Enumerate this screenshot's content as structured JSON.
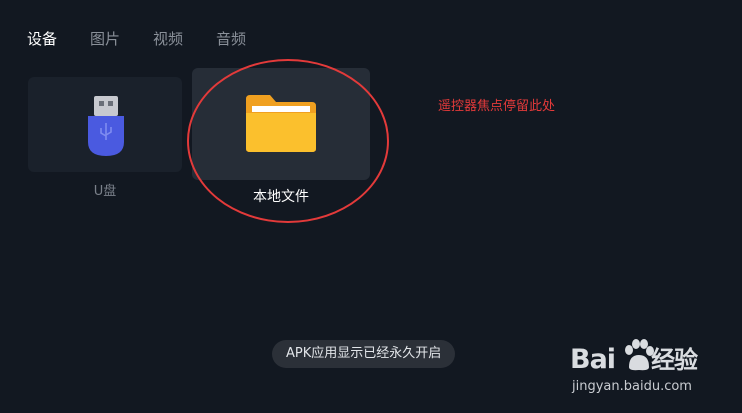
{
  "tabs": [
    {
      "label": "设备",
      "active": true
    },
    {
      "label": "图片",
      "active": false
    },
    {
      "label": "视频",
      "active": false
    },
    {
      "label": "音频",
      "active": false
    }
  ],
  "devices": {
    "usb": {
      "label": "U盘",
      "icon": "usb-drive-icon"
    },
    "local": {
      "label": "本地文件",
      "icon": "folder-icon"
    }
  },
  "annotation": "遥控器焦点停留此处",
  "toast": "APK应用显示已经永久开启",
  "watermark": {
    "logo_a": "Bai",
    "logo_b": "经验",
    "url": "jingyan.baidu.com"
  },
  "colors": {
    "background": "#121821",
    "focus_card": "#262d37",
    "annotation_red": "#e33a3a",
    "folder_yellow": "#fbc02d",
    "usb_blue": "#4a5ae0"
  }
}
